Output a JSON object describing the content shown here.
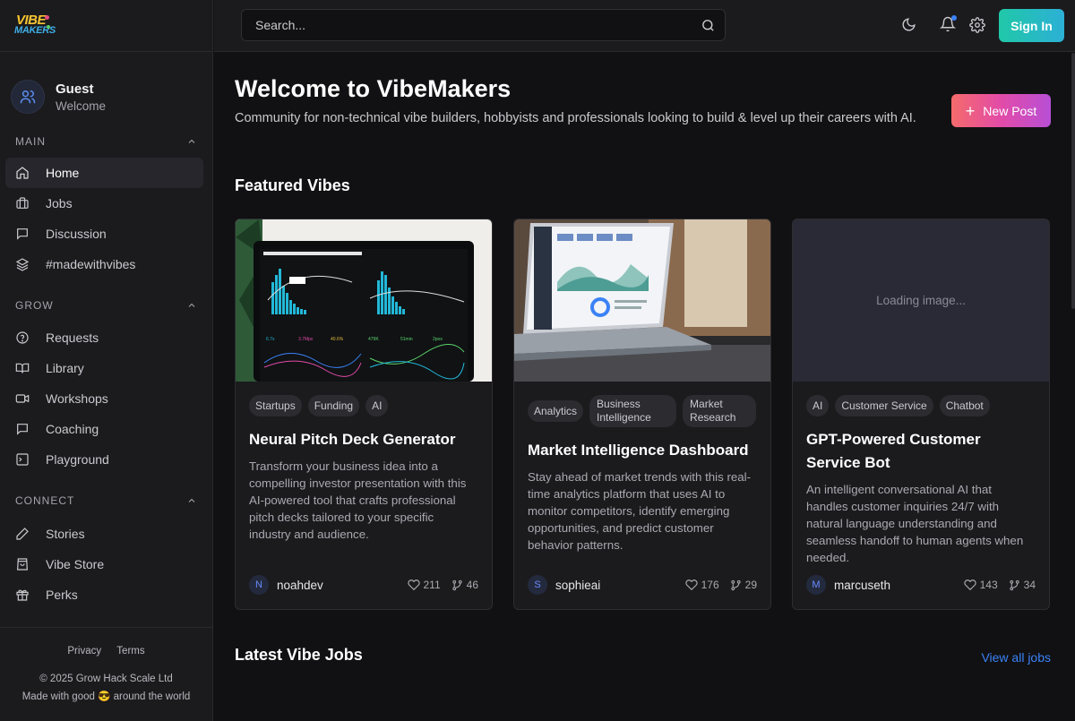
{
  "app": {
    "logo_line1": "VIBE",
    "logo_line2": "MAKERS"
  },
  "user": {
    "name": "Guest",
    "subtitle": "Welcome"
  },
  "sidebar": {
    "sections": [
      {
        "title": "MAIN",
        "items": [
          {
            "label": "Home",
            "icon": "home-icon",
            "active": true
          },
          {
            "label": "Jobs",
            "icon": "briefcase-icon"
          },
          {
            "label": "Discussion",
            "icon": "message-icon"
          },
          {
            "label": "#madewithvibes",
            "icon": "layers-icon"
          }
        ]
      },
      {
        "title": "GROW",
        "items": [
          {
            "label": "Requests",
            "icon": "help-circle-icon"
          },
          {
            "label": "Library",
            "icon": "book-icon"
          },
          {
            "label": "Workshops",
            "icon": "video-icon"
          },
          {
            "label": "Coaching",
            "icon": "chat-icon"
          },
          {
            "label": "Playground",
            "icon": "terminal-icon"
          }
        ]
      },
      {
        "title": "CONNECT",
        "items": [
          {
            "label": "Stories",
            "icon": "pencil-icon"
          },
          {
            "label": "Vibe Store",
            "icon": "bag-icon"
          },
          {
            "label": "Perks",
            "icon": "gift-icon"
          }
        ]
      }
    ],
    "footer": {
      "privacy": "Privacy",
      "terms": "Terms",
      "copyright": "© 2025 Grow Hack Scale Ltd",
      "made_with": "Made with good 😎 around the world"
    }
  },
  "topbar": {
    "search_placeholder": "Search...",
    "sign_in": "Sign In"
  },
  "hero": {
    "title": "Welcome to VibeMakers",
    "subtitle": "Community for non-technical vibe builders, hobbyists and professionals looking to build & level up their careers with AI.",
    "new_post": "New Post"
  },
  "featured": {
    "title": "Featured Vibes",
    "cards": [
      {
        "tags": [
          "Startups",
          "Funding",
          "AI"
        ],
        "title": "Neural Pitch Deck Generator",
        "description": "Transform your business idea into a compelling investor presentation with this AI-powered tool that crafts professional pitch decks tailored to your specific industry and audience.",
        "author": "noahdev",
        "initial": "N",
        "likes": "211",
        "forks": "46"
      },
      {
        "tags": [
          "Analytics",
          "Business Intelligence",
          "Market Research"
        ],
        "title": "Market Intelligence Dashboard",
        "description": "Stay ahead of market trends with this real-time analytics platform that uses AI to monitor competitors, identify emerging opportunities, and predict customer behavior patterns.",
        "author": "sophieai",
        "initial": "S",
        "likes": "176",
        "forks": "29"
      },
      {
        "tags": [
          "AI",
          "Customer Service",
          "Chatbot"
        ],
        "title": "GPT-Powered Customer Service Bot",
        "description": "An intelligent conversational AI that handles customer inquiries 24/7 with natural language understanding and seamless handoff to human agents when needed.",
        "author": "marcuseth",
        "initial": "M",
        "likes": "143",
        "forks": "34",
        "image_status": "Loading image..."
      }
    ]
  },
  "jobs": {
    "title": "Latest Vibe Jobs",
    "view_all": "View all jobs"
  }
}
